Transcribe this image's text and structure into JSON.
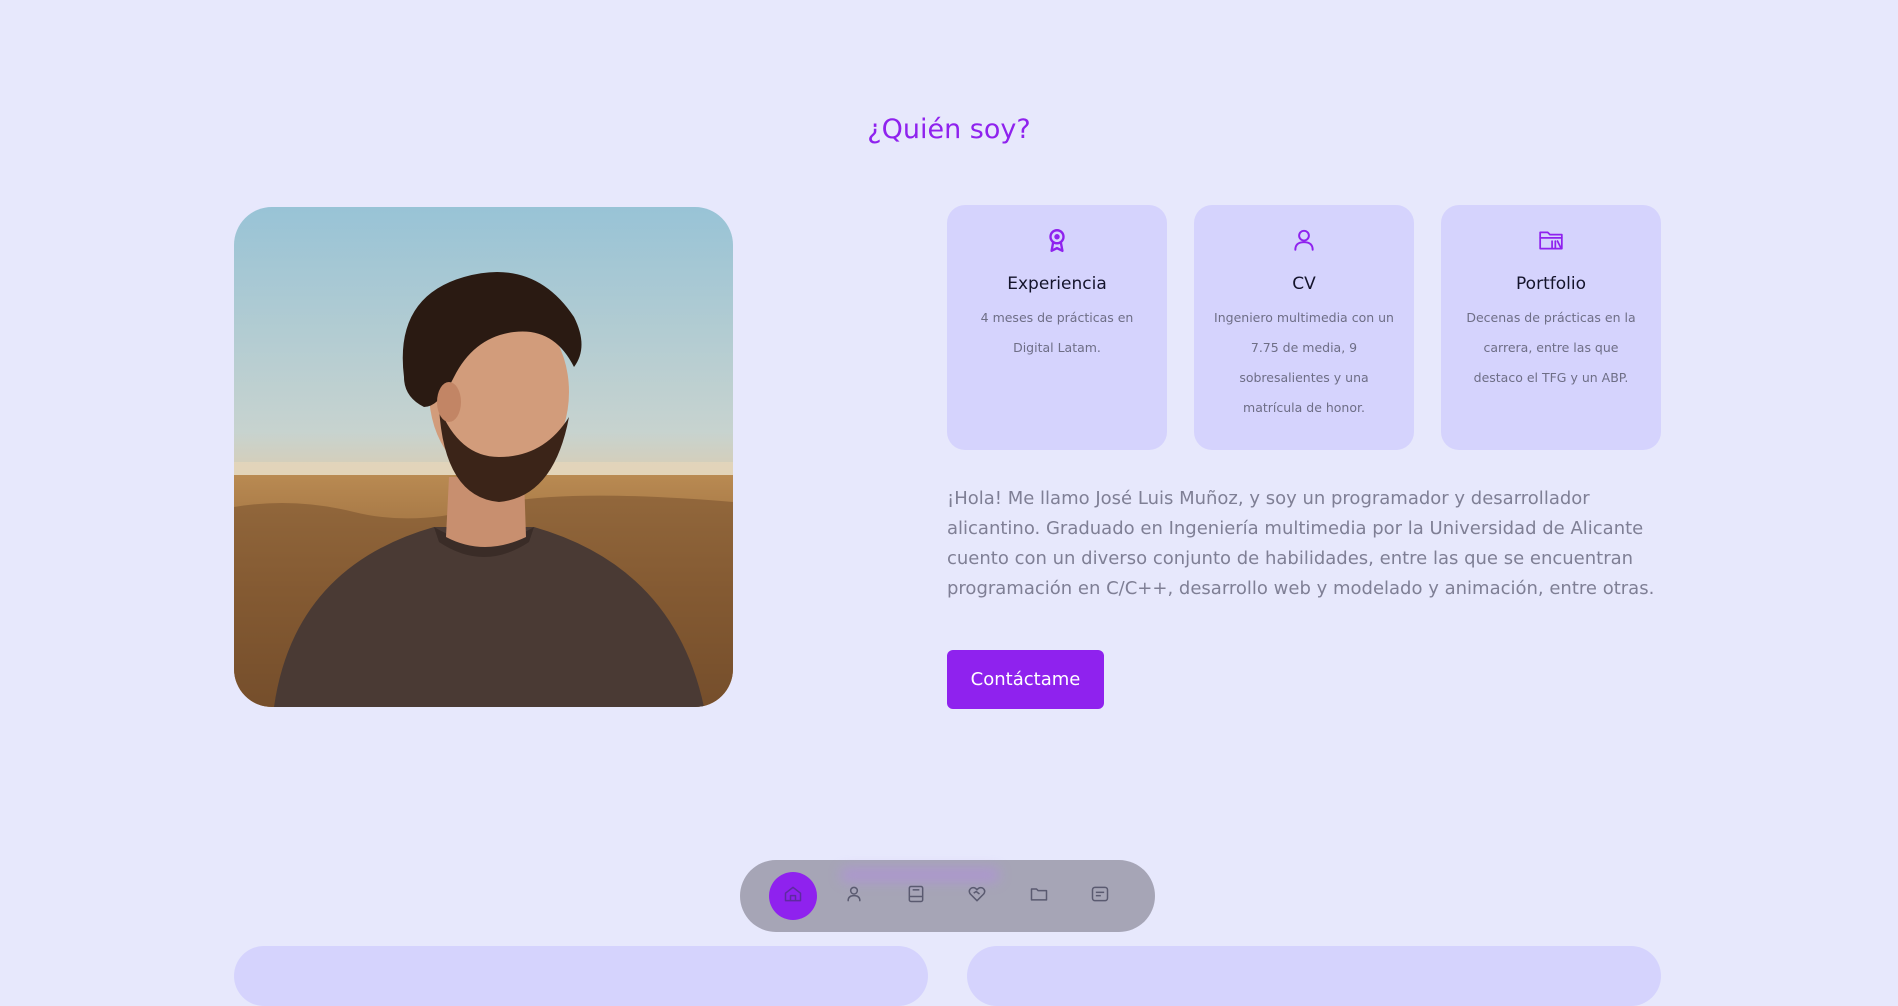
{
  "about": {
    "title": "¿Quién soy?",
    "photo_icon": "portrait-photo",
    "cards": [
      {
        "icon": "award-icon",
        "title": "Experiencia",
        "description": "4 meses de prácticas en Digital Latam."
      },
      {
        "icon": "user-icon",
        "title": "CV",
        "description": "Ingeniero multimedia con un 7.75 de media, 9 sobresalientes y una matrícula de honor."
      },
      {
        "icon": "folder-icon",
        "title": "Portfolio",
        "description": "Decenas de prácticas en la carrera, entre las que destaco el TFG y un ABP."
      }
    ],
    "text": "¡Hola! Me llamo José Luis Muñoz, y soy un programador y desarrollador alicantino. Graduado en Ingeniería multimedia por la Universidad de Alicante cuento con un diverso conjunto de habilidades, entre las que se encuentran programación en C/C++, desarrollo web y modelado y animación, entre otras.",
    "contact_label": "Contáctame"
  },
  "nav": {
    "items": [
      {
        "icon": "home-icon",
        "active": true
      },
      {
        "icon": "user-icon",
        "active": false
      },
      {
        "icon": "book-icon",
        "active": false
      },
      {
        "icon": "handshake-icon",
        "active": false
      },
      {
        "icon": "folder-icon",
        "active": false
      },
      {
        "icon": "message-icon",
        "active": false
      }
    ]
  },
  "colors": {
    "background": "#e7e8fc",
    "accent": "#8f22ee",
    "card": "#d5d3fd",
    "nav_bar": "#a6a5b6"
  }
}
